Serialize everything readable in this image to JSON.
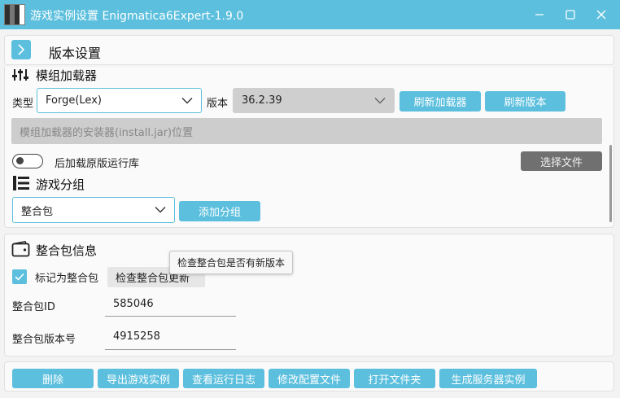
{
  "window": {
    "title": "游戏实例设置 Enigmatica6Expert-1.9.0",
    "min_icon": "minimize-icon",
    "max_icon": "maximize-icon",
    "close_icon": "close-icon"
  },
  "header": {
    "title": "版本设置",
    "expand_icon": "chevron-right-icon"
  },
  "loader": {
    "heading": "模组加载器",
    "type_label": "类型",
    "type_value": "Forge(Lex)",
    "version_label": "版本",
    "version_value": "36.2.39",
    "refresh_loader_label": "刷新加载器",
    "refresh_version_label": "刷新版本",
    "installer_placeholder": "模组加载器的安装器(install.jar)位置",
    "late_load_label": "后加载原版运行库",
    "choose_file_label": "选择文件"
  },
  "group": {
    "heading": "游戏分组",
    "selected": "整合包",
    "add_label": "添加分组"
  },
  "modpack": {
    "heading": "整合包信息",
    "mark_label": "标记为整合包",
    "check_update_label": "检查整合包更新",
    "tooltip": "检查整合包是否有新版本",
    "id_label": "整合包ID",
    "id_value": "585046",
    "version_label": "整合包版本号",
    "version_value": "4915258"
  },
  "footer": {
    "delete_label": "删除",
    "export_label": "导出游戏实例",
    "logs_label": "查看运行日志",
    "config_label": "修改配置文件",
    "open_folder_label": "打开文件夹",
    "server_label": "生成服务器实例"
  },
  "colors": {
    "accent": "#5bbfdd",
    "gray_button": "#707070"
  }
}
